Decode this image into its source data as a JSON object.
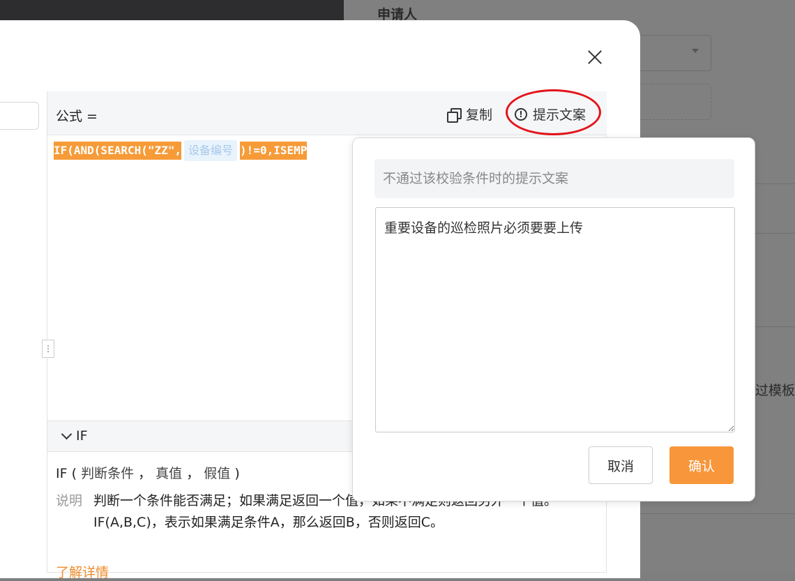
{
  "background": {
    "heading": "申请人",
    "side_text": "过模板"
  },
  "formula_panel": {
    "label": "公式 =",
    "copy_label": "复制",
    "hint_label": "提示文案",
    "code_before": "IF(AND(SEARCH(\"ZZ\",",
    "code_field_tag": "设备编号",
    "code_after": ")!=0,ISEMP"
  },
  "function_help": {
    "section_title": "IF",
    "signature_name": "IF",
    "signature_open": "(",
    "arg1": "判断条件",
    "arg2": "真值",
    "arg3": "假值",
    "signature_close": ")",
    "desc_label": "说明",
    "desc_line1": "判断一个条件能否满足；如果满足返回一个值，如果不满足则返回另外一个值。",
    "desc_line2": "IF(A,B,C)，表示如果满足条件A，那么返回B，否则返回C。",
    "learn_more": "了解详情"
  },
  "hint_popover": {
    "title_placeholder": "不通过该校验条件时的提示文案",
    "message_value": "重要设备的巡检照片必须要要上传",
    "cancel_label": "取消",
    "confirm_label": "确认"
  },
  "colors": {
    "accent": "#f7963a",
    "highlight_oval": "#e3141a"
  }
}
